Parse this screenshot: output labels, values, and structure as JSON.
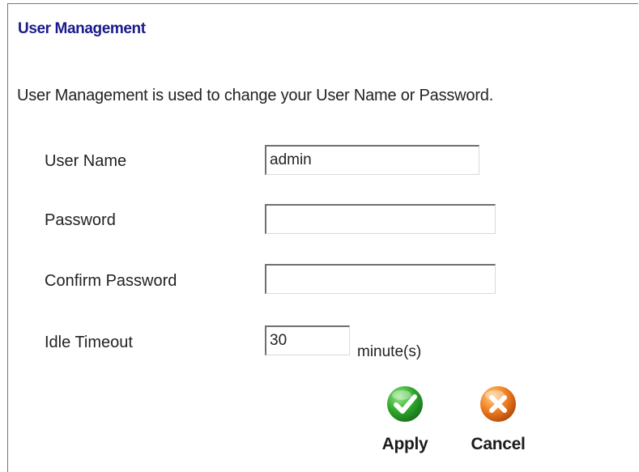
{
  "page": {
    "title": "User Management",
    "description": "User Management is used to change your User Name or Password."
  },
  "form": {
    "username": {
      "label": "User Name",
      "value": "admin"
    },
    "password": {
      "label": "Password",
      "value": ""
    },
    "confirm_password": {
      "label": "Confirm Password",
      "value": ""
    },
    "idle_timeout": {
      "label": "Idle Timeout",
      "value": "30",
      "unit": "minute(s)"
    }
  },
  "actions": {
    "apply": {
      "label": "Apply",
      "icon": "checkmark-icon",
      "color": "#2fa82b"
    },
    "cancel": {
      "label": "Cancel",
      "icon": "close-icon",
      "color": "#f07d1e"
    }
  }
}
